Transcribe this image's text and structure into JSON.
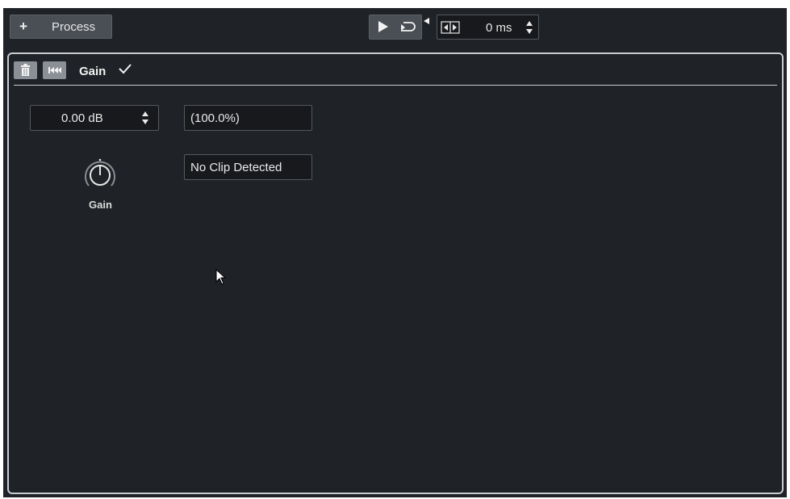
{
  "toolbar": {
    "process_label": "Process",
    "plus_glyph": "+",
    "preroll_value": "0 ms",
    "icons": [
      "plus-icon",
      "play-icon",
      "loop-icon",
      "marker-icon",
      "width-icon",
      "stepper-icon"
    ]
  },
  "panel": {
    "title": "Gain",
    "icons": [
      "trash-icon",
      "rewind-icon",
      "check-icon"
    ],
    "gain_value": "0.00 dB",
    "percent_value": "(100.0%)",
    "clip_status": "No Clip Detected",
    "knob_label": "Gain"
  },
  "colors": {
    "background": "#1f2226",
    "button": "#4a4f55",
    "field": "#17191c",
    "border": "#c9ccd0",
    "text": "#eaeaea"
  }
}
